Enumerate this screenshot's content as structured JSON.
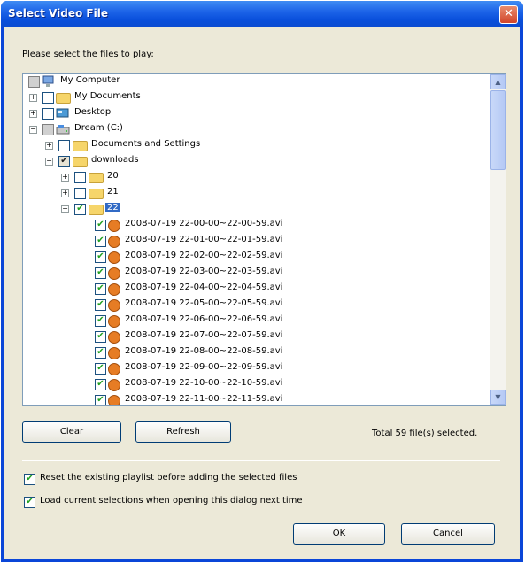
{
  "dialog": {
    "title": "Select Video File",
    "close_glyph": "✕",
    "prompt": "Please select the files to play:"
  },
  "tree": {
    "nodes": [
      {
        "label": "My Computer",
        "icon": "computer-icon",
        "check": "gray",
        "selected": false
      },
      {
        "label": "My Documents",
        "icon": "folder-icon",
        "check": "unchecked",
        "selected": false
      },
      {
        "label": "Desktop",
        "icon": "desktop-icon",
        "check": "unchecked",
        "selected": false
      },
      {
        "label": "Dream (C:)",
        "icon": "drive-icon",
        "check": "gray",
        "selected": false
      },
      {
        "label": "Documents and Settings",
        "icon": "folder-icon",
        "check": "unchecked",
        "selected": false
      },
      {
        "label": "downloads",
        "icon": "folder-icon",
        "check": "partial",
        "selected": false
      },
      {
        "label": "20",
        "icon": "folder-icon",
        "check": "unchecked",
        "selected": false
      },
      {
        "label": "21",
        "icon": "folder-icon",
        "check": "unchecked",
        "selected": false
      },
      {
        "label": "22",
        "icon": "folder-icon",
        "check": "checked",
        "selected": true
      },
      {
        "label": "2008-07-19 22-00-00~22-00-59.avi",
        "icon": "video-file-icon",
        "check": "checked",
        "selected": false
      },
      {
        "label": "2008-07-19 22-01-00~22-01-59.avi",
        "icon": "video-file-icon",
        "check": "checked",
        "selected": false
      },
      {
        "label": "2008-07-19 22-02-00~22-02-59.avi",
        "icon": "video-file-icon",
        "check": "checked",
        "selected": false
      },
      {
        "label": "2008-07-19 22-03-00~22-03-59.avi",
        "icon": "video-file-icon",
        "check": "checked",
        "selected": false
      },
      {
        "label": "2008-07-19 22-04-00~22-04-59.avi",
        "icon": "video-file-icon",
        "check": "checked",
        "selected": false
      },
      {
        "label": "2008-07-19 22-05-00~22-05-59.avi",
        "icon": "video-file-icon",
        "check": "checked",
        "selected": false
      },
      {
        "label": "2008-07-19 22-06-00~22-06-59.avi",
        "icon": "video-file-icon",
        "check": "checked",
        "selected": false
      },
      {
        "label": "2008-07-19 22-07-00~22-07-59.avi",
        "icon": "video-file-icon",
        "check": "checked",
        "selected": false
      },
      {
        "label": "2008-07-19 22-08-00~22-08-59.avi",
        "icon": "video-file-icon",
        "check": "checked",
        "selected": false
      },
      {
        "label": "2008-07-19 22-09-00~22-09-59.avi",
        "icon": "video-file-icon",
        "check": "checked",
        "selected": false
      },
      {
        "label": "2008-07-19 22-10-00~22-10-59.avi",
        "icon": "video-file-icon",
        "check": "checked",
        "selected": false
      },
      {
        "label": "2008-07-19 22-11-00~22-11-59.avi",
        "icon": "video-file-icon",
        "check": "checked",
        "selected": false
      }
    ]
  },
  "buttons": {
    "clear": "Clear",
    "refresh": "Refresh",
    "ok": "OK",
    "cancel": "Cancel"
  },
  "status": "Total 59 file(s) selected.",
  "options": {
    "reset_playlist": {
      "label": "Reset the existing playlist before adding the selected files",
      "checked": true
    },
    "load_selections": {
      "label": "Load current selections when opening this dialog next time",
      "checked": true
    }
  },
  "colors": {
    "title_bar": "#0a50dc",
    "dialog_bg": "#ece9d8",
    "selection": "#316ac5"
  }
}
